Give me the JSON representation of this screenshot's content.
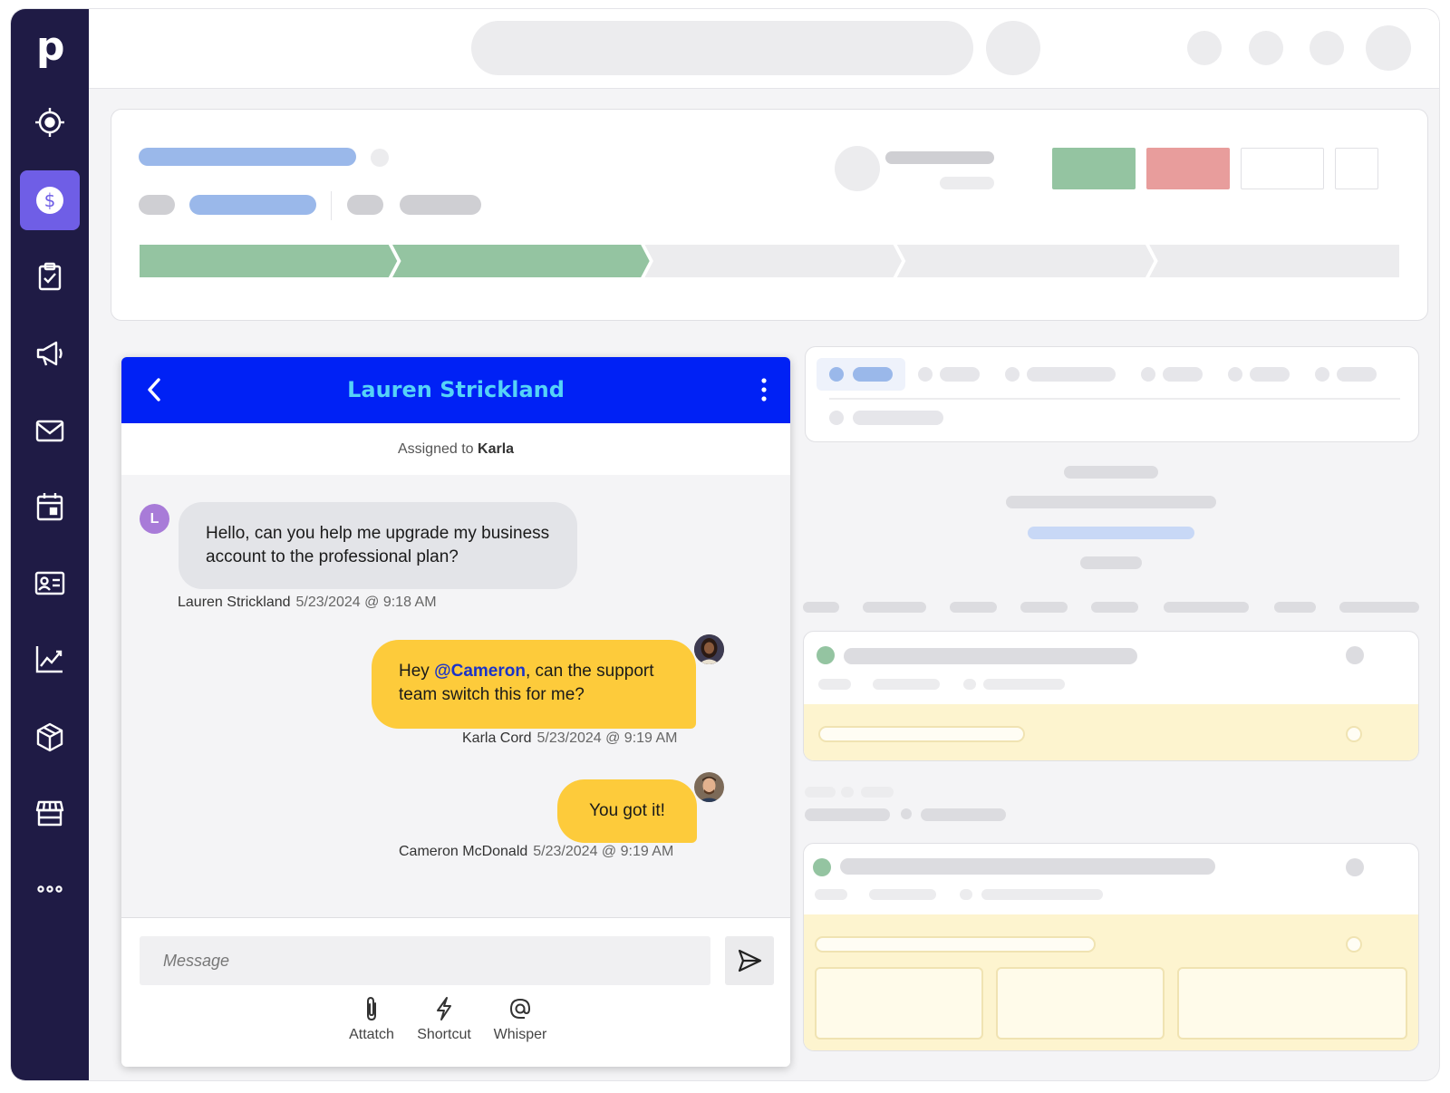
{
  "sidebar": {
    "logo": "p",
    "items": [
      {
        "icon": "target-icon"
      },
      {
        "icon": "dollar-icon",
        "active": true
      },
      {
        "icon": "clipboard-check-icon"
      },
      {
        "icon": "megaphone-icon"
      },
      {
        "icon": "mail-icon"
      },
      {
        "icon": "calendar-icon"
      },
      {
        "icon": "contact-card-icon"
      },
      {
        "icon": "chart-icon"
      },
      {
        "icon": "box-icon"
      },
      {
        "icon": "store-icon"
      },
      {
        "icon": "more-icon"
      }
    ],
    "accent_color": "#6f5ee6",
    "background_color": "#1f1b45"
  },
  "chat": {
    "title": "Lauren Strickland",
    "assigned_prefix": "Assigned to",
    "assigned_name": "Karla",
    "header_color": "#0021f5",
    "messages": [
      {
        "avatar_initial": "L",
        "text": "Hello, can you help me upgrade my business account to the professional plan?",
        "author": "Lauren Strickland",
        "timestamp": "5/23/2024 @ 9:18 AM"
      },
      {
        "text_prefix": "Hey ",
        "mention": "@Cameron",
        "text_suffix": ", can the support team switch this for me?",
        "author": "Karla Cord",
        "timestamp": "5/23/2024 @ 9:19 AM"
      },
      {
        "text": "You got it!",
        "author": "Cameron McDonald",
        "timestamp": "5/23/2024 @ 9:19 AM"
      }
    ],
    "composer": {
      "placeholder": "Message",
      "tools": [
        {
          "label": "Attatch",
          "icon": "paperclip-icon"
        },
        {
          "label": "Shortcut",
          "icon": "lightning-icon"
        },
        {
          "label": "Whisper",
          "icon": "at-sign-icon"
        }
      ]
    },
    "bubble_color": "#fdcb3b"
  },
  "deal": {
    "won_color": "#94c4a1",
    "lost_color": "#e89d9c",
    "pipeline_stages_complete": 2,
    "pipeline_stages_total": 5
  }
}
